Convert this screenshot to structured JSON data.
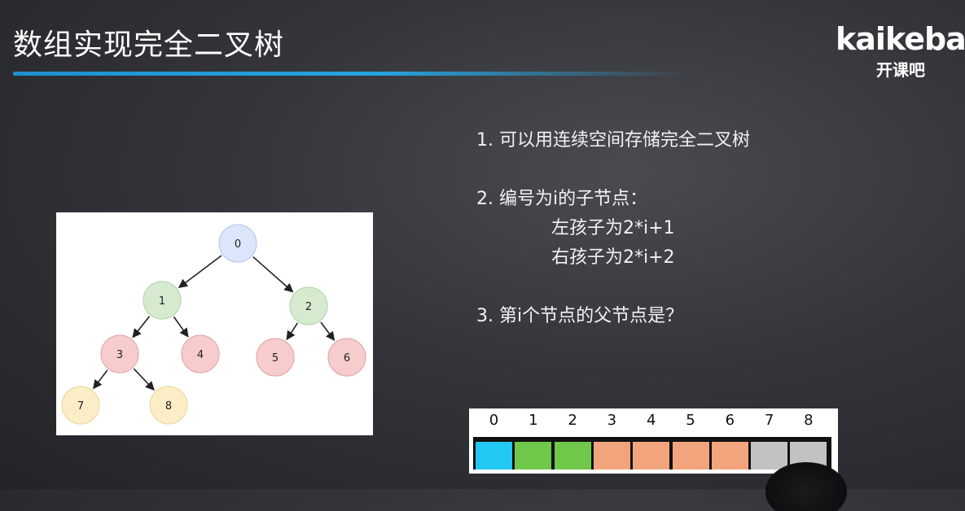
{
  "slide": {
    "title": "数组实现完全二叉树",
    "points": [
      "1. 可以用连续空间存储完全二叉树",
      "2. 编号为i的子节点：",
      "左孩子为2*i+1",
      "右孩子为2*i+2",
      "3. 第i个节点的父节点是？"
    ]
  },
  "logo": {
    "word": "kaikeba",
    "sub": "开课吧"
  },
  "tree": {
    "nodes": [
      {
        "label": "0",
        "color": "#dbe6fb",
        "stroke": "#b9c9ee"
      },
      {
        "label": "1",
        "color": "#d6ead0",
        "stroke": "#b6d6ac"
      },
      {
        "label": "2",
        "color": "#d6ead0",
        "stroke": "#b6d6ac"
      },
      {
        "label": "3",
        "color": "#f6cccd",
        "stroke": "#e7a9ab"
      },
      {
        "label": "4",
        "color": "#f6cccd",
        "stroke": "#e7a9ab"
      },
      {
        "label": "5",
        "color": "#f6cccd",
        "stroke": "#e7a9ab"
      },
      {
        "label": "6",
        "color": "#f6cccd",
        "stroke": "#e7a9ab"
      },
      {
        "label": "7",
        "color": "#fbeec6",
        "stroke": "#ecd9a0"
      },
      {
        "label": "8",
        "color": "#fbeec6",
        "stroke": "#ecd9a0"
      }
    ]
  },
  "array": {
    "indices": [
      "0",
      "1",
      "2",
      "3",
      "4",
      "5",
      "6",
      "7",
      "8"
    ],
    "colors": [
      "#22c8f2",
      "#70c84a",
      "#70c84a",
      "#f2a57c",
      "#f2a57c",
      "#f2a57c",
      "#f2a57c",
      "#c4c1c2",
      "#c4c1c2"
    ]
  }
}
